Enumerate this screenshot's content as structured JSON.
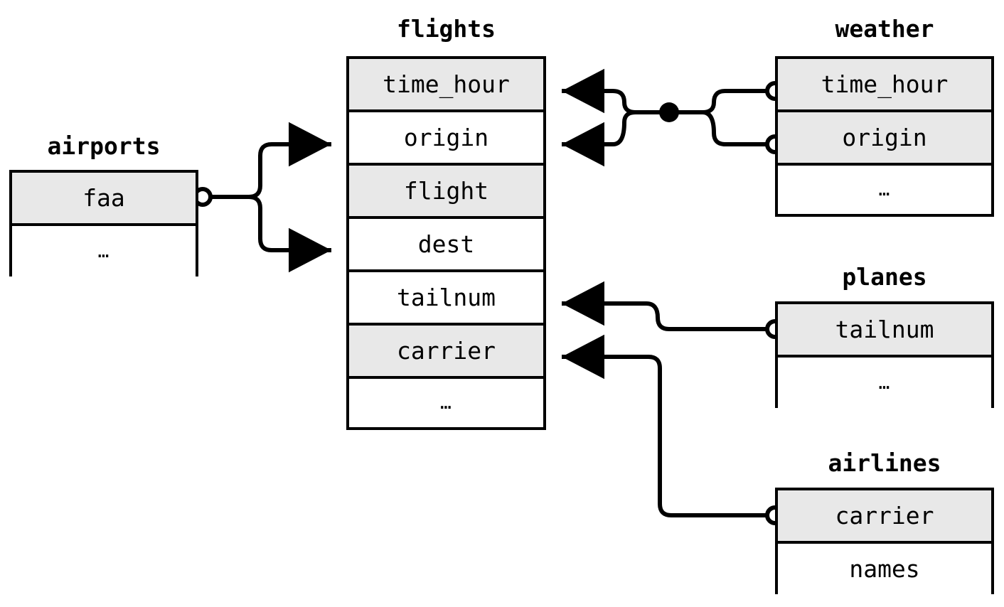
{
  "diagram": {
    "kind": "entity-relationship-diagram",
    "background_color": "#ffffff",
    "line_color": "#000000",
    "key_field_fill": "#e8e8e8",
    "plain_field_fill": "#ffffff"
  },
  "tables": {
    "airports": {
      "title": "airports",
      "rows": [
        {
          "label": "faa",
          "key": true
        },
        {
          "label": "…",
          "key": false,
          "ellipsis": true
        }
      ]
    },
    "flights": {
      "title": "flights",
      "rows": [
        {
          "label": "time_hour",
          "key": true
        },
        {
          "label": "origin",
          "key": false
        },
        {
          "label": "flight",
          "key": true
        },
        {
          "label": "dest",
          "key": false
        },
        {
          "label": "tailnum",
          "key": false
        },
        {
          "label": "carrier",
          "key": true
        },
        {
          "label": "…",
          "key": false,
          "ellipsis": true
        }
      ]
    },
    "weather": {
      "title": "weather",
      "rows": [
        {
          "label": "time_hour",
          "key": true
        },
        {
          "label": "origin",
          "key": true
        },
        {
          "label": "…",
          "key": false,
          "ellipsis": true
        }
      ]
    },
    "planes": {
      "title": "planes",
      "rows": [
        {
          "label": "tailnum",
          "key": true
        },
        {
          "label": "…",
          "key": false,
          "ellipsis": true
        }
      ]
    },
    "airlines": {
      "title": "airlines",
      "rows": [
        {
          "label": "carrier",
          "key": true
        },
        {
          "label": "names",
          "key": false
        }
      ]
    }
  },
  "relationships": [
    {
      "name": "airports-to-flights",
      "from_table": "airports",
      "from_field": "faa",
      "to_table": "flights",
      "to_fields": [
        "origin",
        "dest"
      ],
      "from_marker": "circle",
      "to_marker": "arrow"
    },
    {
      "name": "weather-to-flights",
      "from_table": "weather",
      "from_fields": [
        "time_hour",
        "origin"
      ],
      "to_table": "flights",
      "to_fields": [
        "time_hour",
        "origin"
      ],
      "from_marker": "circle",
      "to_marker": "arrow",
      "junction": "dot"
    },
    {
      "name": "planes-to-flights",
      "from_table": "planes",
      "from_field": "tailnum",
      "to_table": "flights",
      "to_fields": [
        "tailnum"
      ],
      "from_marker": "circle",
      "to_marker": "arrow"
    },
    {
      "name": "airlines-to-flights",
      "from_table": "airlines",
      "from_field": "carrier",
      "to_table": "flights",
      "to_fields": [
        "carrier"
      ],
      "from_marker": "circle",
      "to_marker": "arrow"
    }
  ]
}
